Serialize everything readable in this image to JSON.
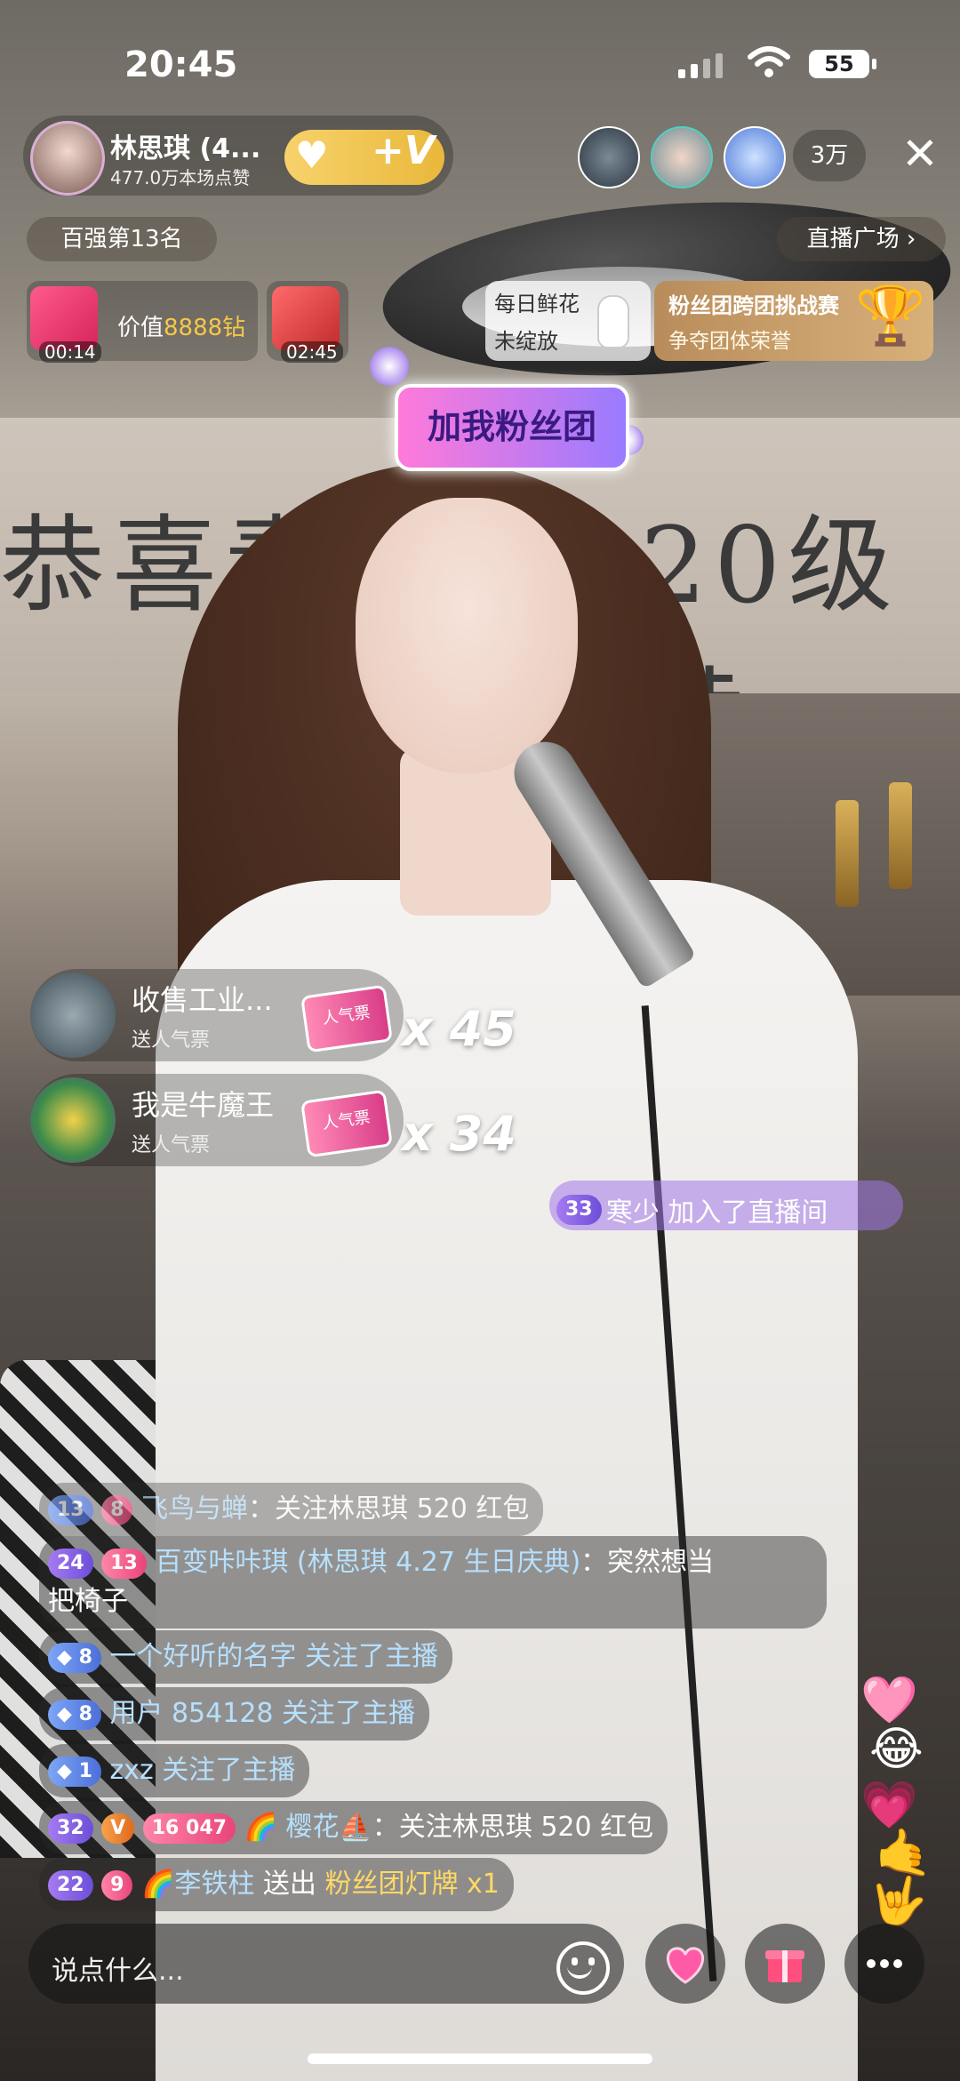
{
  "status_bar": {
    "time": "20:45",
    "battery": "55"
  },
  "host": {
    "name": "林思琪 (4...",
    "likes": "477.0万本场点赞",
    "follow_badge": "+V"
  },
  "viewers": {
    "count": "3万"
  },
  "rank": {
    "label": "百强第13名"
  },
  "plaza": {
    "label": "直播广场 ›"
  },
  "gift_timers": [
    {
      "time": "00:14",
      "label_prefix": "价值",
      "label_value": "8888钻"
    },
    {
      "time": "02:45"
    }
  ],
  "flower": {
    "title": "每日鲜花",
    "status": "未绽放"
  },
  "fan_challenge": {
    "title": "粉丝团跨团挑战赛",
    "subtitle": "争夺团体荣誉"
  },
  "fanclub_sign": "加我粉丝团",
  "background_banner": {
    "left": "恭喜青",
    "right": "20级黄"
  },
  "gift_feed": [
    {
      "user": "收售工业...",
      "sub": "送人气票",
      "ticket": "人气票",
      "combo": "x 45"
    },
    {
      "user": "我是牛魔王",
      "sub": "送人气票",
      "ticket": "人气票",
      "combo": "x 34"
    }
  ],
  "join_notice": {
    "level": "33",
    "text": "寒少 加入了直播间"
  },
  "chat": [
    {
      "lv": "13",
      "fan": "8",
      "user": "飞鸟与蝉",
      "msg": "：关注林思琪 520 红包"
    },
    {
      "lv": "24",
      "fan": "13",
      "user": "百变咔咔琪 (林思琪 4.27 生日庆典)",
      "msg": "：突然想当",
      "msg2": "把椅子"
    },
    {
      "lv": "8",
      "user": "一个好听的名字",
      "msg": " 关注了主播"
    },
    {
      "lv": "8",
      "user": "用户 854128",
      "msg": " 关注了主播"
    },
    {
      "lv": "1",
      "user": "zxz",
      "msg": " 关注了主播"
    },
    {
      "lv": "32",
      "badge": "V",
      "fan": "16",
      "fan_extra": "047",
      "user": "🌈 樱花⛵",
      "msg": "：关注林思琪 520 红包"
    },
    {
      "lv": "22",
      "fan": "9",
      "user": "🌈李铁柱",
      "action": " 送出 ",
      "gift": "粉丝团灯牌",
      "qty": " x1"
    }
  ],
  "input": {
    "placeholder": "说点什么..."
  },
  "icons": {
    "close": "close-icon",
    "emoji": "smile-icon",
    "heart": "heart-icon",
    "gift": "gift-icon",
    "more": "more-icon"
  },
  "colors": {
    "accent_gold": "#f5c84a",
    "accent_purple": "#9a7bff",
    "chat_user": "#b6e0ff"
  }
}
